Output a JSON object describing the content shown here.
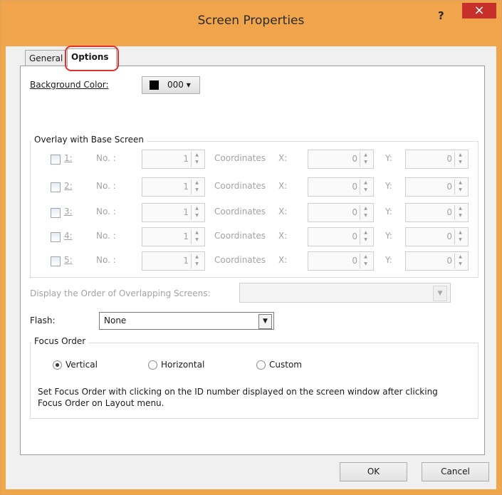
{
  "window": {
    "title": "Screen Properties",
    "help_label": "?",
    "close_label": "×"
  },
  "tabs": [
    {
      "label": "General"
    },
    {
      "label": "Options"
    }
  ],
  "background_color": {
    "label": "Background Color:",
    "value": "000",
    "swatch_color": "#000000"
  },
  "overlay": {
    "legend": "Overlay with Base Screen",
    "no_label": "No. :",
    "coordinates_label": "Coordinates",
    "x_label": "X:",
    "y_label": "Y:",
    "rows": [
      {
        "label": "1:",
        "no": "1",
        "x": "0",
        "y": "0"
      },
      {
        "label": "2:",
        "no": "1",
        "x": "0",
        "y": "0"
      },
      {
        "label": "3:",
        "no": "1",
        "x": "0",
        "y": "0"
      },
      {
        "label": "4:",
        "no": "1",
        "x": "0",
        "y": "0"
      },
      {
        "label": "5:",
        "no": "1",
        "x": "0",
        "y": "0"
      }
    ]
  },
  "display_order": {
    "label": "Display the Order of Overlapping Screens:",
    "value": ""
  },
  "flash": {
    "label": "Flash:",
    "value": "None"
  },
  "focus_order": {
    "legend": "Focus Order",
    "options": [
      {
        "label": "Vertical",
        "selected": true
      },
      {
        "label": "Horizontal",
        "selected": false
      },
      {
        "label": "Custom",
        "selected": false
      }
    ],
    "note_line1": "Set Focus Order with clicking on the ID number displayed on the screen window after clicking",
    "note_line2": "Focus Order on Layout menu."
  },
  "buttons": {
    "ok": "OK",
    "cancel": "Cancel"
  },
  "icons": {
    "help": "help-icon",
    "close": "close-icon",
    "spin_up": "up-arrow-icon",
    "spin_down": "down-arrow-icon",
    "dropdown": "chevron-down-icon"
  }
}
